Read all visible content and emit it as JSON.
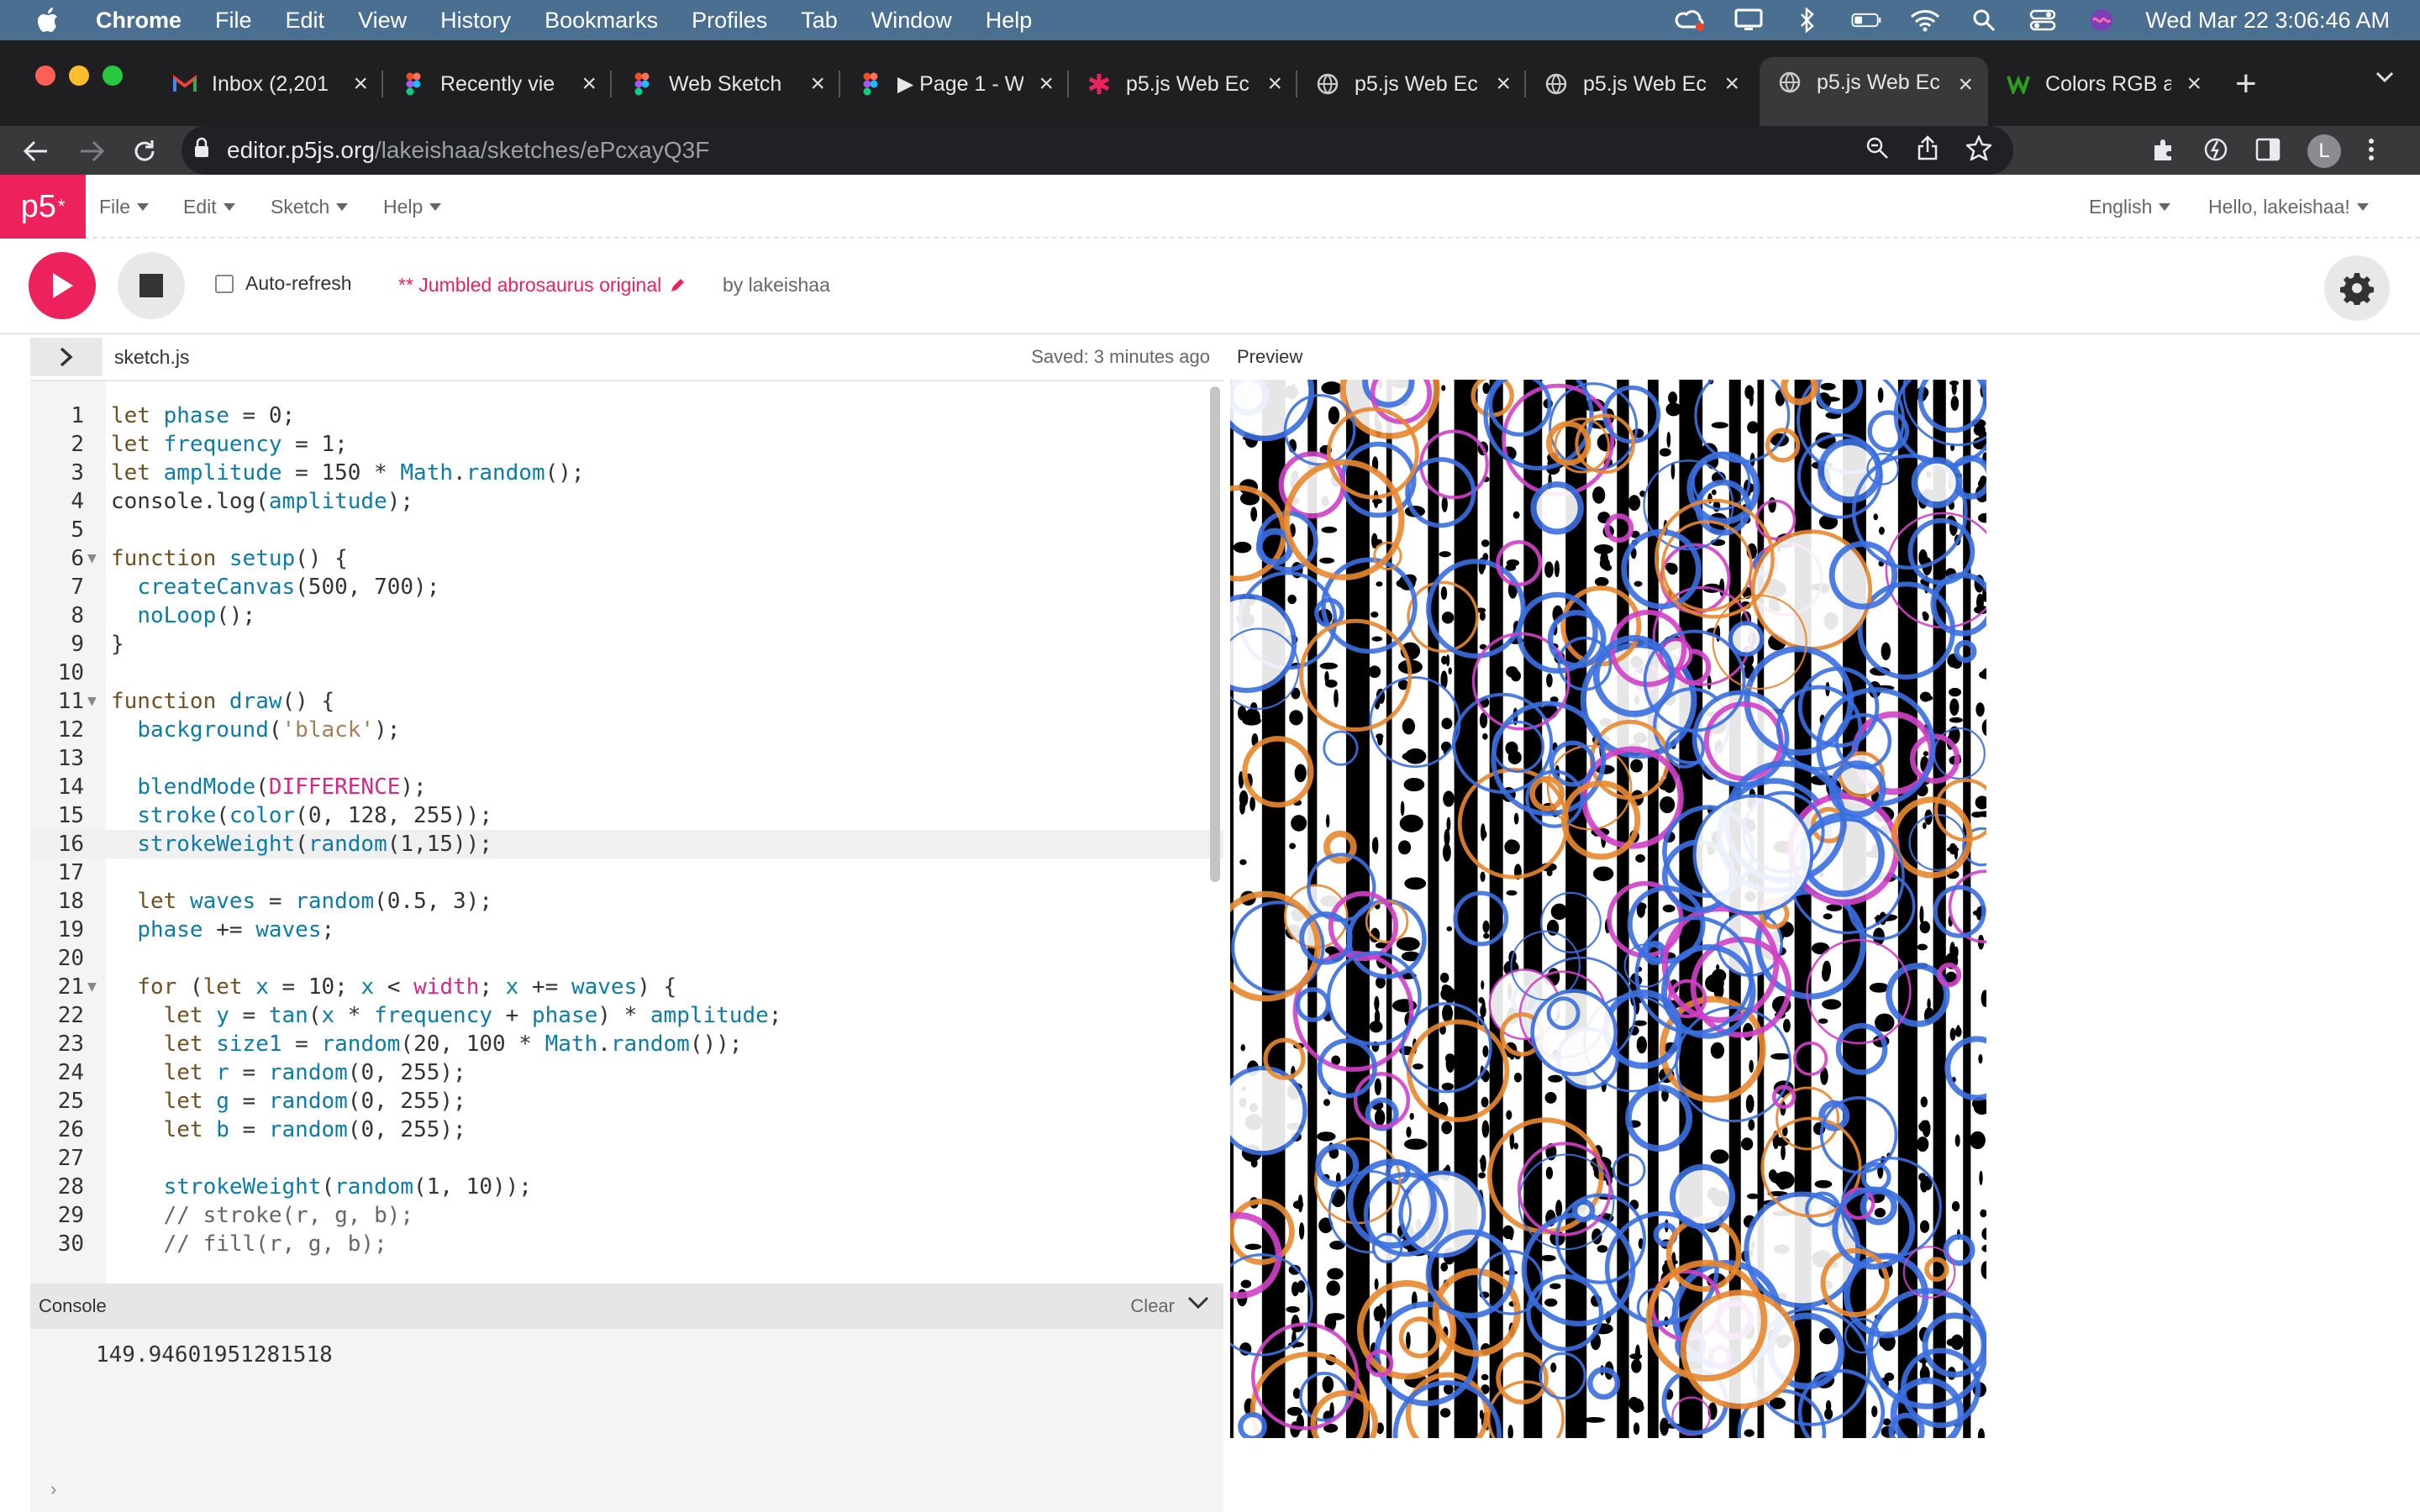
{
  "menubar": {
    "app": "Chrome",
    "items": [
      "File",
      "Edit",
      "View",
      "History",
      "Bookmarks",
      "Profiles",
      "Tab",
      "Window",
      "Help"
    ],
    "datetime": "Wed Mar 22  3:06:46 AM"
  },
  "tabs": [
    {
      "title": "Inbox (2,201",
      "favicon": "gmail-icon"
    },
    {
      "title": "Recently vie",
      "favicon": "figma-icon"
    },
    {
      "title": "Web Sketch",
      "favicon": "figma-icon"
    },
    {
      "title": "▶ Page 1 - W",
      "favicon": "figma-icon"
    },
    {
      "title": "p5.js Web Ec",
      "favicon": "asterisk-icon"
    },
    {
      "title": "p5.js Web Ec",
      "favicon": "globe-icon"
    },
    {
      "title": "p5.js Web Ec",
      "favicon": "globe-icon"
    },
    {
      "title": "p5.js Web Ec",
      "favicon": "globe-icon"
    },
    {
      "title": "Colors RGB a",
      "favicon": "w-icon"
    }
  ],
  "address": {
    "host": "editor.p5js.org",
    "path": "/lakeishaa/sketches/ePcxayQ3F"
  },
  "profile_initial": "L",
  "p5menu": {
    "logo": "p5",
    "logo_sup": "*",
    "file": "File",
    "edit": "Edit",
    "sketch": "Sketch",
    "help": "Help",
    "language": "English",
    "user": "Hello, lakeishaa!"
  },
  "toolbar": {
    "autorefresh": "Auto-refresh",
    "sketch_name": "** Jumbled abrosaurus original",
    "by": "by lakeishaa"
  },
  "editor": {
    "filename": "sketch.js",
    "saved": "Saved: 3 minutes ago",
    "preview_label": "Preview",
    "lines": [
      "let phase = 0;",
      "let frequency = 1;",
      "let amplitude = 150 * Math.random();",
      "console.log(amplitude);",
      "",
      "function setup() {",
      "  createCanvas(500, 700);",
      "  noLoop();",
      "}",
      "",
      "function draw() {",
      "  background('black');",
      "",
      "  blendMode(DIFFERENCE);",
      "  stroke(color(0, 128, 255));",
      "  strokeWeight(random(1,15));",
      "",
      "  let waves = random(0.5, 3);",
      "  phase += waves;",
      "",
      "  for (let x = 10; x < width; x += waves) {",
      "    let y = tan(x * frequency + phase) * amplitude;",
      "    let size1 = random(20, 100 * Math.random());",
      "    let r = random(0, 255);",
      "    let g = random(0, 255);",
      "    let b = random(0, 255);",
      "",
      "    strokeWeight(random(1, 10));",
      "    // stroke(r, g, b);",
      "    // fill(r, g, b);"
    ]
  },
  "console": {
    "title": "Console",
    "clear": "Clear",
    "output": "149.94601951281518"
  },
  "colors": {
    "p5_pink": "#ed225d",
    "menubar_bg": "#4b6f90",
    "chrome_dark": "#1f1f21",
    "stroke_blue": "#0080ff",
    "stroke_orange": "#ff8000"
  }
}
